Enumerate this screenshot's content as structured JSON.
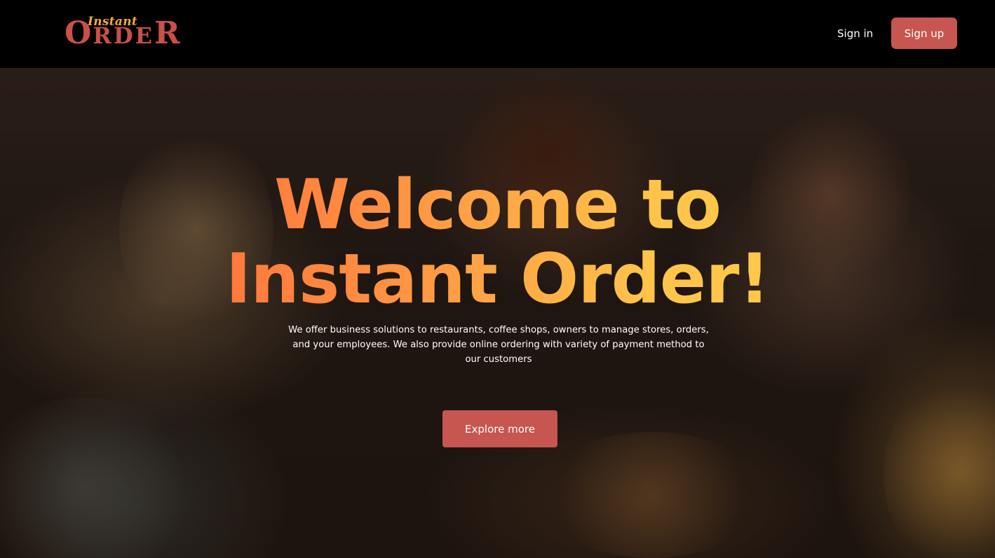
{
  "brand": {
    "logo_top": "Instant",
    "logo_main_first": "O",
    "logo_main_middle": "RDE",
    "logo_main_last": "R"
  },
  "nav": {
    "signin_label": "Sign in",
    "signup_label": "Sign up"
  },
  "hero": {
    "title_line1": "Welcome to",
    "title_line2": "Instant Order!",
    "description": "We offer business solutions to restaurants, coffee shops, owners to manage stores, orders, and your employees. We also provide online ordering with variety of payment method to our customers",
    "cta_label": "Explore more"
  },
  "colors": {
    "header_bg": "#000000",
    "accent": "#c6564f",
    "logo_gold": "#f2a93b",
    "title_gradient_start": "#ff5b37",
    "title_gradient_end": "#ffd24a"
  }
}
